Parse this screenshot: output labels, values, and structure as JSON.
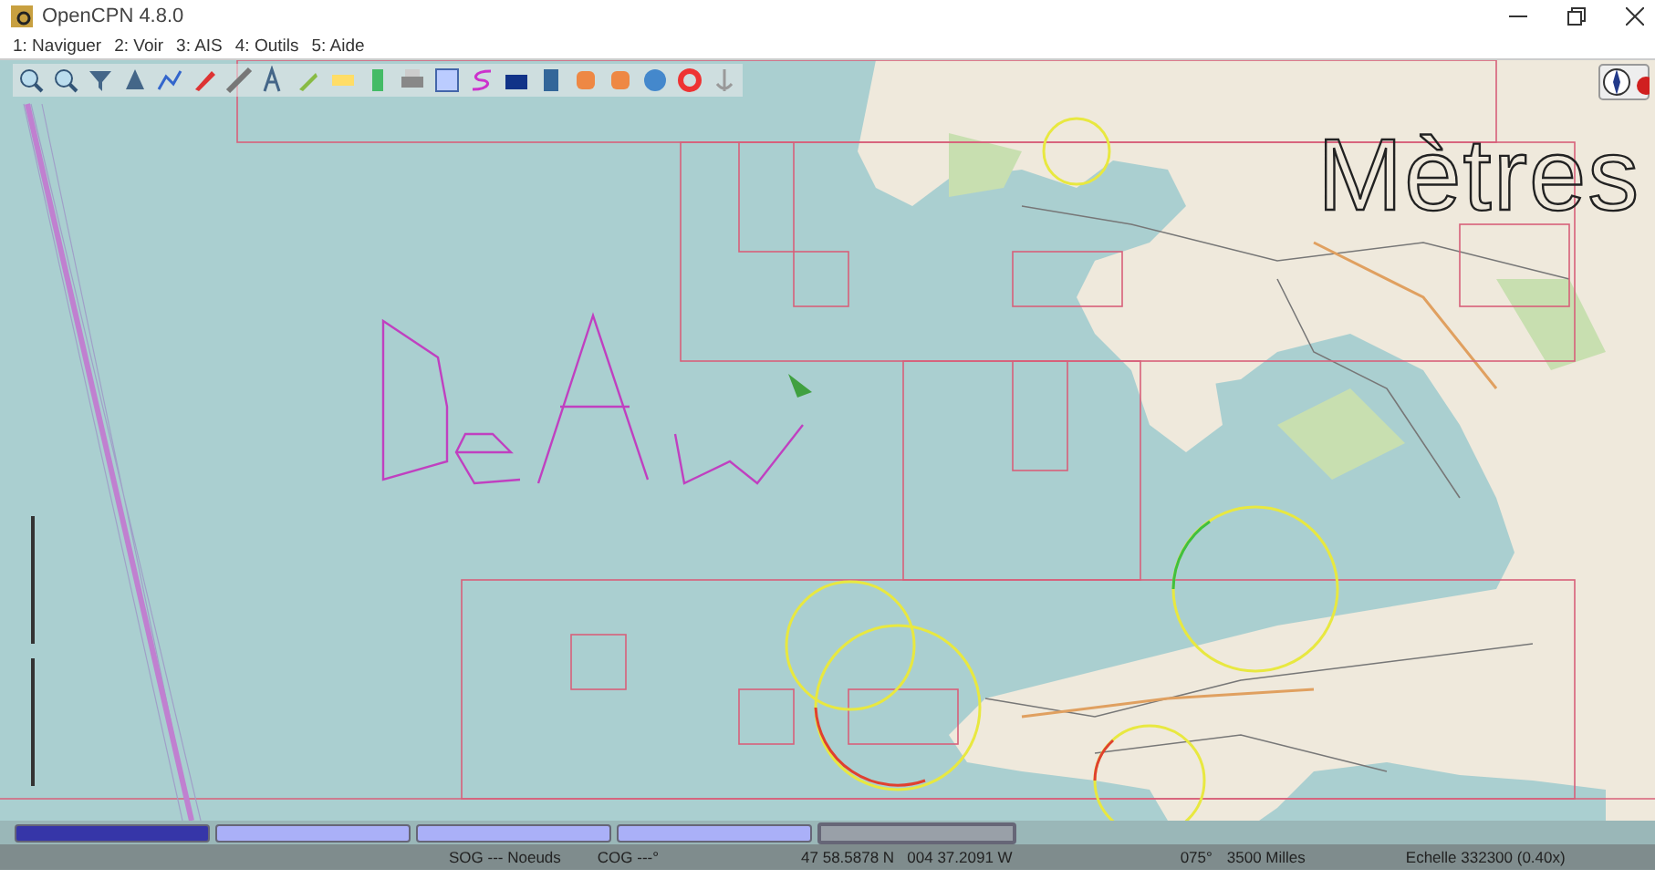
{
  "window": {
    "title": "OpenCPN 4.8.0"
  },
  "menu": [
    {
      "label": "1: Naviguer"
    },
    {
      "label": "2: Voir"
    },
    {
      "label": "3: AIS"
    },
    {
      "label": "4: Outils"
    },
    {
      "label": "5: Aide"
    }
  ],
  "map": {
    "overlay_text": "Mètres"
  },
  "chart_bar": [
    {
      "selected": true,
      "outlined": false
    },
    {
      "selected": false,
      "outlined": false
    },
    {
      "selected": false,
      "outlined": false
    },
    {
      "selected": false,
      "outlined": false
    },
    {
      "selected": false,
      "outlined": true
    }
  ],
  "status_bar": {
    "sog": "SOG --- Noeuds",
    "cog": "COG ---°",
    "position": "47 58.5878 N   004 37.2091 W",
    "bearing": "075°",
    "distance": "3500 Milles",
    "scale": "Echelle 332300 (0.40x)"
  }
}
